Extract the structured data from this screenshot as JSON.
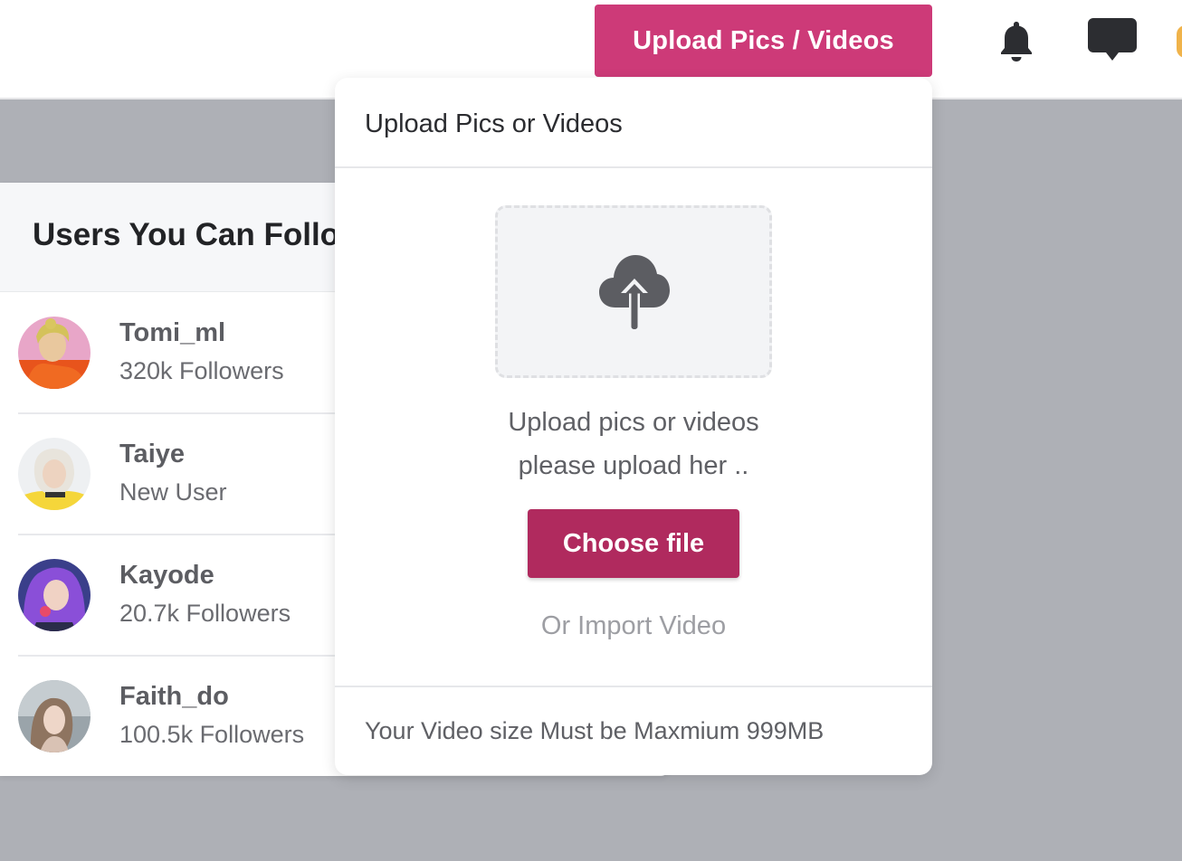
{
  "header": {
    "upload_button_label": "Upload Pics / Videos",
    "icons": [
      "bell-icon",
      "chat-icon",
      "user-avatar"
    ]
  },
  "follow_panel": {
    "title": "Users You Can Follow",
    "users": [
      {
        "name": "Tomi_ml",
        "subtitle": "320k Followers"
      },
      {
        "name": "Taiye",
        "subtitle": "New User"
      },
      {
        "name": "Kayode",
        "subtitle": "20.7k Followers"
      },
      {
        "name": "Faith_do",
        "subtitle": "100.5k Followers"
      }
    ]
  },
  "upload_modal": {
    "title": "Upload Pics or Videos",
    "dropzone_icon": "cloud-upload-icon",
    "description_line1": "Upload pics or videos",
    "description_line2": "please upload her ..",
    "choose_file_label": "Choose file",
    "import_link": "Or Import Video",
    "footer_note": "Your Video size Must be Maxmium 999MB"
  },
  "colors": {
    "brand_pink": "#cd3a78",
    "button_dark_pink": "#b02a5e",
    "backdrop": "#aeb0b6"
  }
}
